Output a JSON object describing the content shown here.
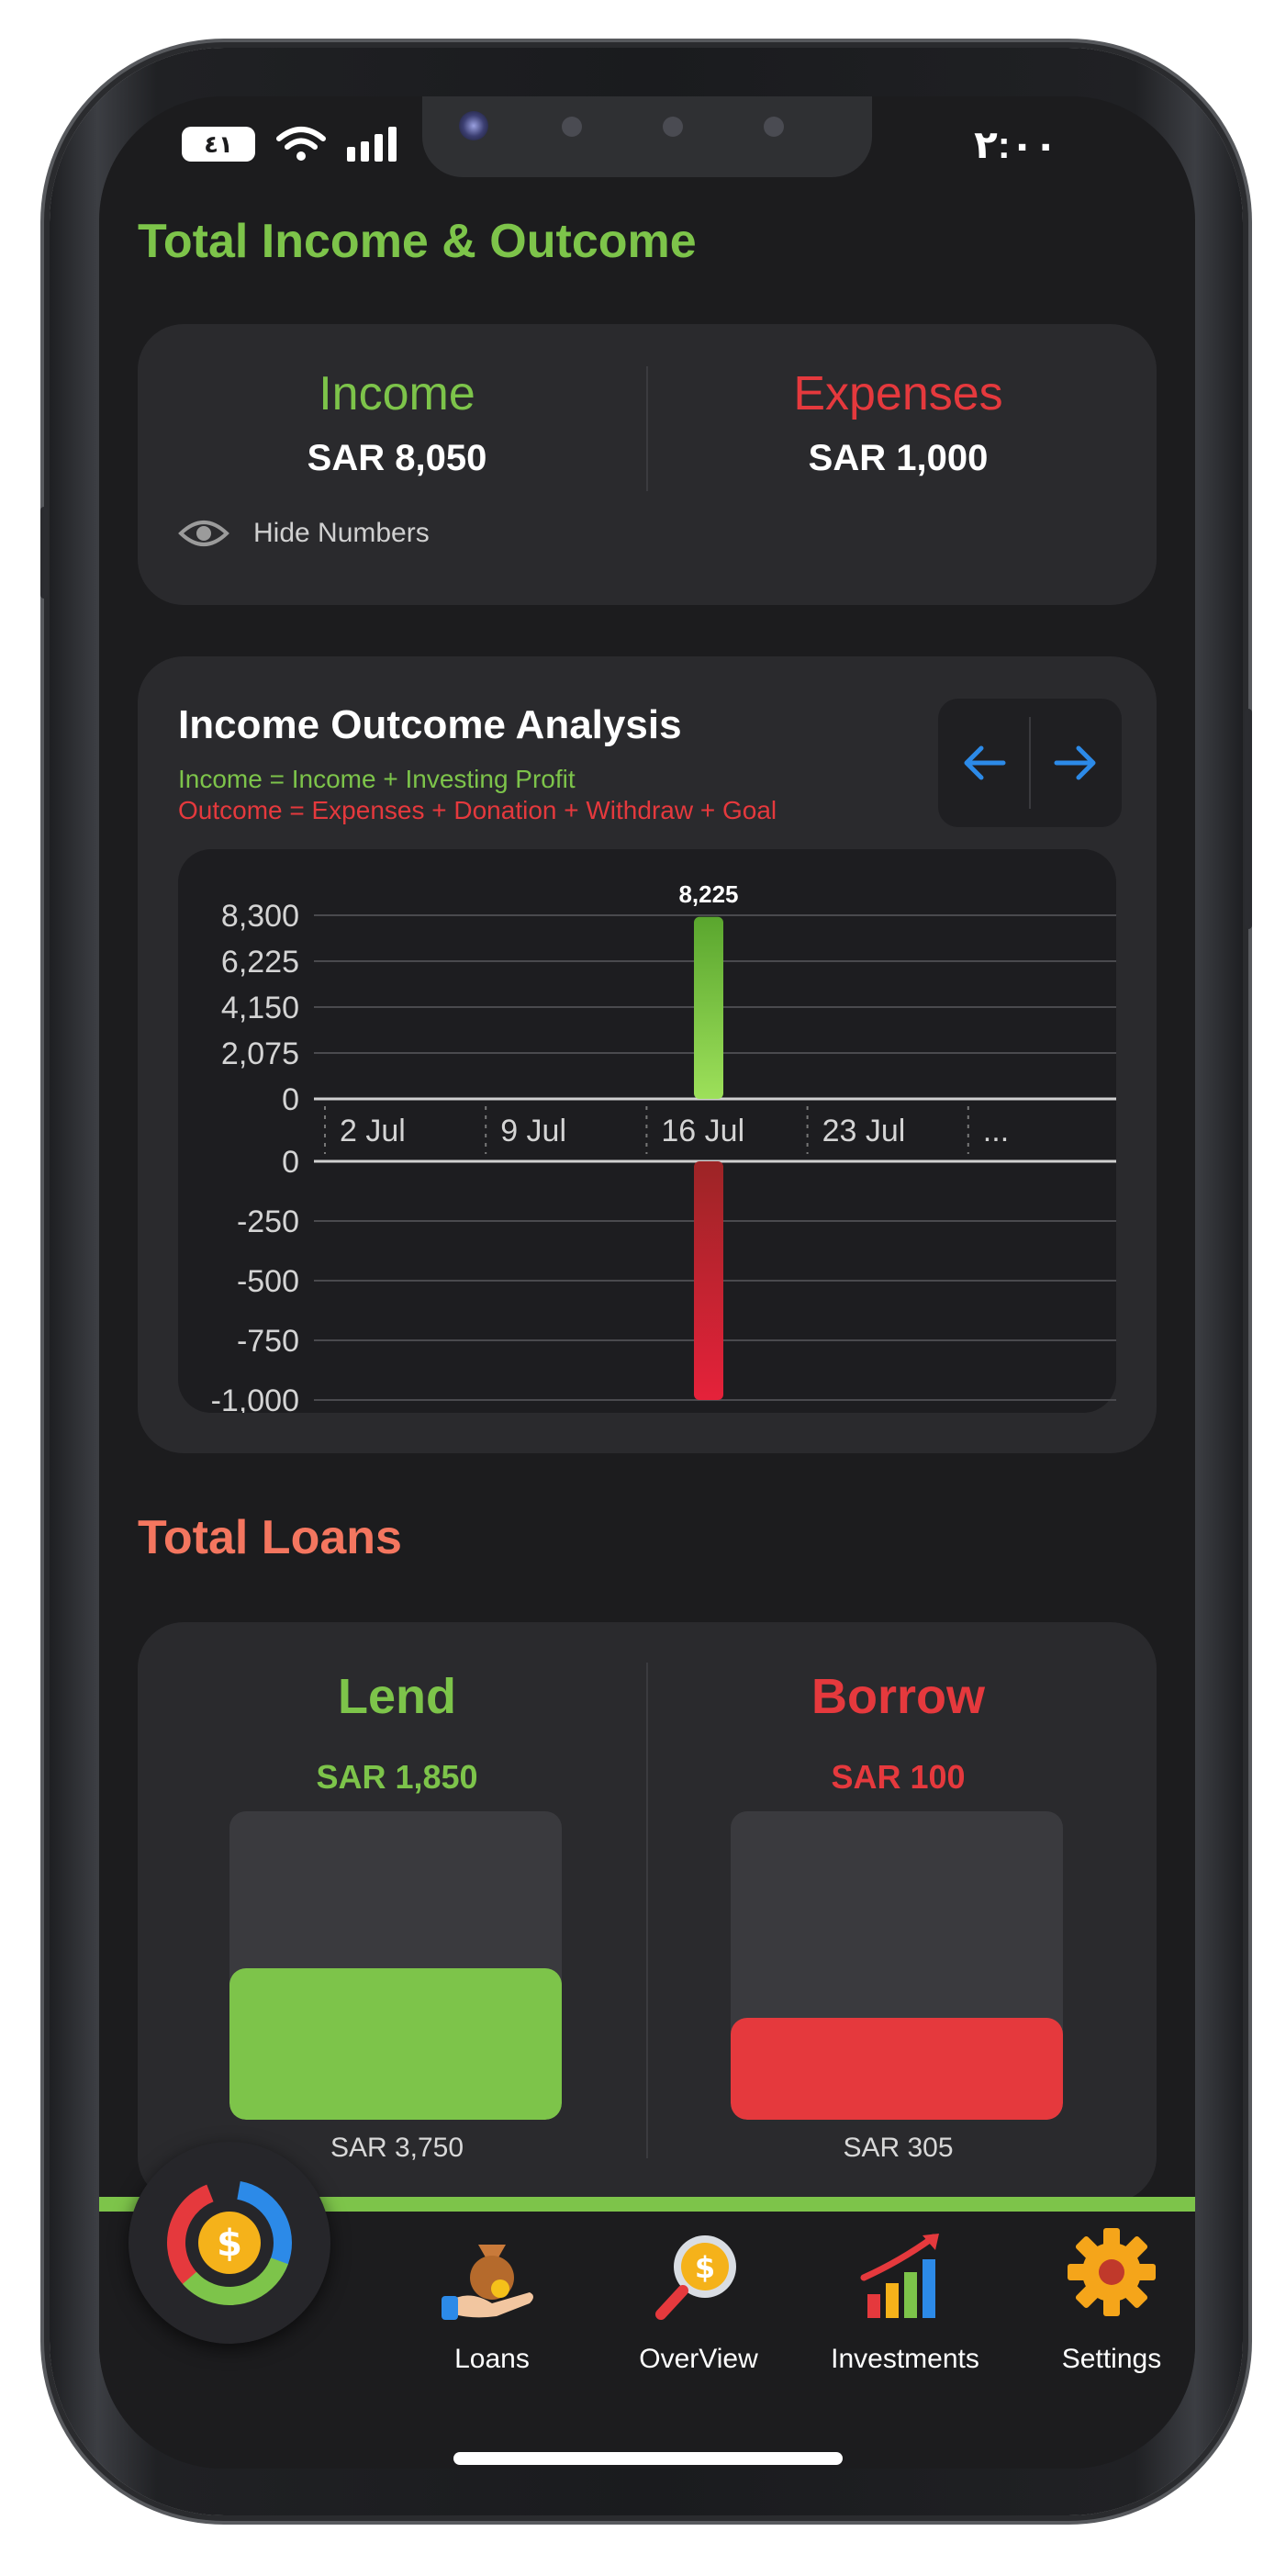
{
  "status_bar": {
    "time": "٢:٠٠",
    "battery": "٤١"
  },
  "income_section": {
    "title": "Total Income & Outcome",
    "income_label": "Income",
    "income_value": "SAR 8,050",
    "expenses_label": "Expenses",
    "expenses_value": "SAR 1,000",
    "hide_label": "Hide Numbers"
  },
  "analysis": {
    "title": "Income Outcome Analysis",
    "income_formula": "Income = Income + Investing Profit",
    "outcome_formula": "Outcome = Expenses + Donation + Withdraw + Goal",
    "prev_icon": "arrow-left",
    "next_icon": "arrow-right"
  },
  "chart_data": {
    "type": "bar",
    "categories": [
      "2 Jul",
      "9 Jul",
      "16 Jul",
      "23 Jul",
      "..."
    ],
    "series": [
      {
        "values": [
          0,
          0,
          8225,
          0,
          0
        ],
        "color": "#7dc44a"
      },
      {
        "values": [
          0,
          0,
          -1000,
          0,
          0
        ],
        "color": "#e0283a"
      }
    ],
    "income_ticks": [
      "8,300",
      "6,225",
      "4,150",
      "2,075",
      "0"
    ],
    "outcome_ticks": [
      "0",
      "-250",
      "-500",
      "-750",
      "-1,000"
    ],
    "income_ylim": [
      0,
      8300
    ],
    "outcome_ylim": [
      -1000,
      0
    ],
    "data_labels": {
      "income": "8,225",
      "outcome": "1,000"
    },
    "highlight_index": 2,
    "grid": true
  },
  "loans_section": {
    "title": "Total Loans",
    "lend_label": "Lend",
    "lend_value": "SAR 1,850",
    "lend_total": "SAR 3,750",
    "lend_fraction": 0.49,
    "borrow_label": "Borrow",
    "borrow_value": "SAR 100",
    "borrow_total": "SAR 305",
    "borrow_fraction": 0.33
  },
  "colors": {
    "green": "#7dc44a",
    "red": "#e5393d",
    "salmon": "#f4765f",
    "blue": "#2c8ae8"
  },
  "tabbar": {
    "fab_icon": "dollar-donut-icon",
    "tabs": [
      {
        "label": "Loans",
        "icon": "money-bag-hand-icon"
      },
      {
        "label": "OverView",
        "icon": "coin-magnifier-icon"
      },
      {
        "label": "Investments",
        "icon": "growth-chart-icon"
      },
      {
        "label": "Settings",
        "icon": "gear-icon"
      }
    ]
  }
}
